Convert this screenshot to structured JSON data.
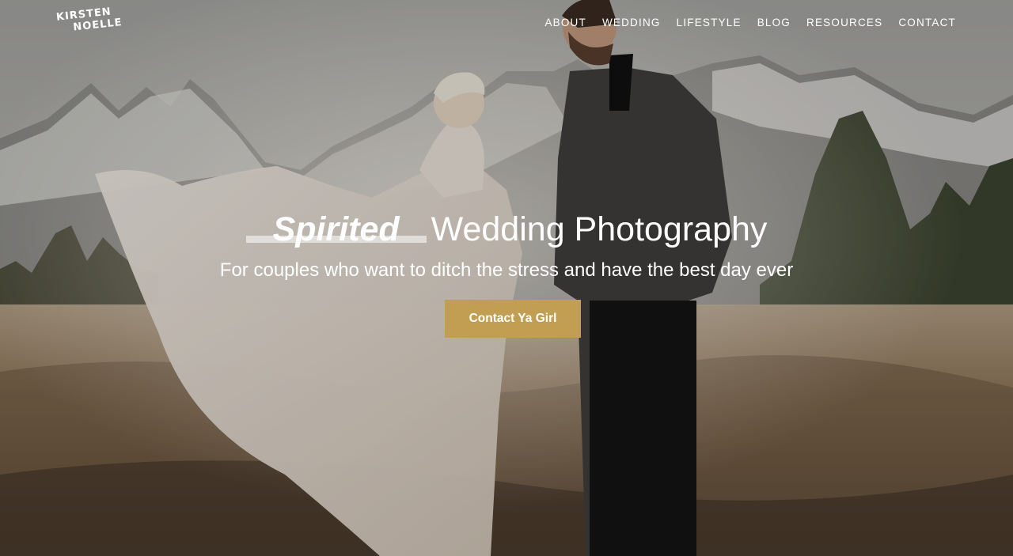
{
  "brand": {
    "logo_line1": "KIRSTEN",
    "logo_line2": "NOELLE"
  },
  "nav": {
    "items": [
      {
        "label": "ABOUT"
      },
      {
        "label": "WEDDING"
      },
      {
        "label": "LIFESTYLE"
      },
      {
        "label": "BLOG"
      },
      {
        "label": "RESOURCES"
      },
      {
        "label": "CONTACT"
      }
    ]
  },
  "hero": {
    "headline_accent": "Spirited",
    "headline_rest": "Wedding Photography",
    "subheadline": "For couples who want to ditch the stress and have the best day ever",
    "cta_label": "Contact Ya Girl"
  },
  "colors": {
    "cta_background": "#c29e53",
    "text": "#ffffff"
  }
}
